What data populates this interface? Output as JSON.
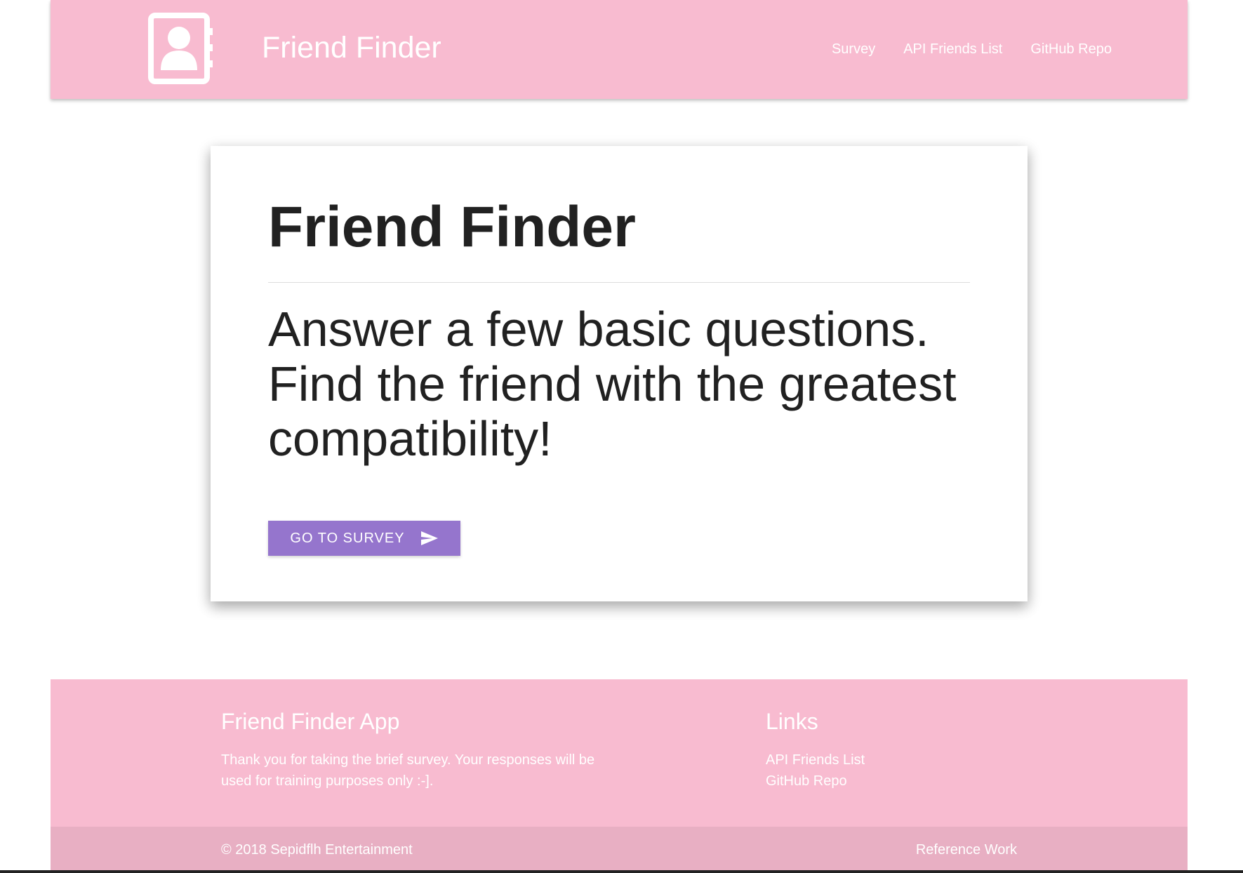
{
  "navbar": {
    "brand_title": "Friend Finder",
    "logo_icon": "contact-book-icon",
    "links": [
      "Survey",
      "API Friends List",
      "GitHub Repo"
    ]
  },
  "card": {
    "title": "Friend Finder",
    "line1": "Answer a few basic questions.",
    "line2": "Find the friend with the greatest compatibility!",
    "button_label": "GO TO SURVEY",
    "button_icon": "send-icon"
  },
  "footer": {
    "app_heading": "Friend Finder App",
    "app_text": "Thank you for taking the brief survey. Your responses will be used for training purposes only :-].",
    "links_heading": "Links",
    "links": [
      "API Friends List",
      "GitHub Repo"
    ],
    "copyright": "© 2018 Sepidflh Entertainment",
    "reference": "Reference Work"
  },
  "colors": {
    "navbar_bg": "#f8bbd0",
    "footer_copyright_bg": "#e8afc3",
    "button_bg": "#9575cd",
    "text_dark": "#212121"
  }
}
